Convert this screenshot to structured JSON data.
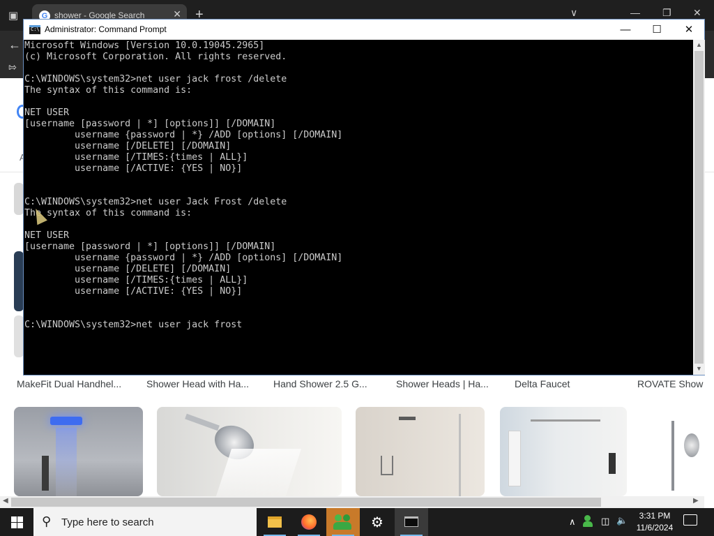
{
  "browser": {
    "tab_title": "shower - Google Search",
    "tab_favicon_letter": "G",
    "side_text": "A",
    "image_captions": [
      "MakeFit Dual Handhel...",
      "Shower Head with Ha...",
      "Hand Shower 2.5 G...",
      "Shower Heads | Ha...",
      "Delta Faucet",
      "ROVATE Show"
    ]
  },
  "cmd": {
    "title": "Administrator: Command Prompt",
    "icon_label": "C:\\",
    "lines": [
      "Microsoft Windows [Version 10.0.19045.2965]",
      "(c) Microsoft Corporation. All rights reserved.",
      "",
      "C:\\WINDOWS\\system32>net user jack frost /delete",
      "The syntax of this command is:",
      "",
      "NET USER",
      "[username [password | *] [options]] [/DOMAIN]",
      "         username {password | *} /ADD [options] [/DOMAIN]",
      "         username [/DELETE] [/DOMAIN]",
      "         username [/TIMES:{times | ALL}]",
      "         username [/ACTIVE: {YES | NO}]",
      "",
      "",
      "C:\\WINDOWS\\system32>net user Jack Frost /delete",
      "The syntax of this command is:",
      "",
      "NET USER",
      "[username [password | *] [options]] [/DOMAIN]",
      "         username {password | *} /ADD [options] [/DOMAIN]",
      "         username [/DELETE] [/DOMAIN]",
      "         username [/TIMES:{times | ALL}]",
      "         username [/ACTIVE: {YES | NO}]",
      "",
      "",
      "C:\\WINDOWS\\system32>net user jack frost"
    ]
  },
  "taskbar": {
    "search_placeholder": "Type here to search",
    "time": "3:31 PM",
    "date": "11/6/2024",
    "apps": [
      "file-explorer-icon",
      "firefox-icon",
      "people-icon",
      "settings-icon",
      "command-prompt-icon"
    ]
  },
  "colors": {
    "cmd_background": "#000000",
    "cmd_text": "#cccccc",
    "taskbar": "#1c1c1c",
    "browser_dark": "#1f1f1f",
    "accent": "#76b9ed"
  }
}
